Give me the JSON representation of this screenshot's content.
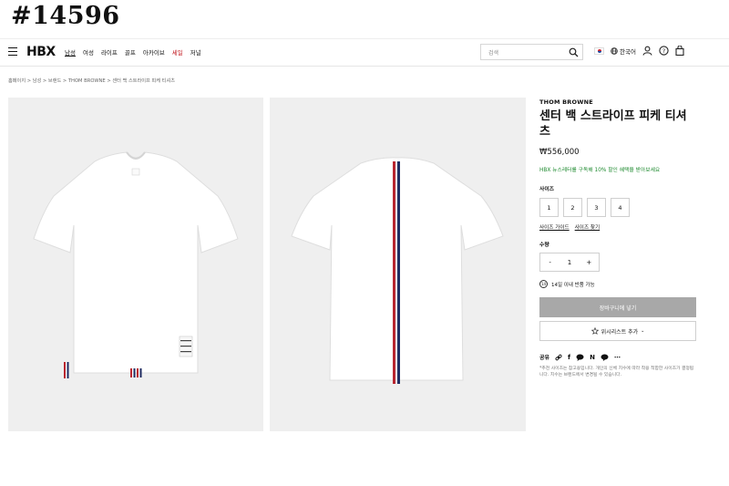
{
  "tag": "#14596",
  "header": {
    "logo": "HBX",
    "nav": [
      "남성",
      "여성",
      "라이프",
      "골프",
      "아카이브",
      "세일",
      "저널"
    ],
    "search_placeholder": "검색",
    "language": "한국어"
  },
  "breadcrumb": "홈페이지 > 남성 > 브랜드 > THOM BROWNE > 센터 백 스트라이프 피케 티셔츠",
  "product": {
    "brand": "THOM BROWNE",
    "title": "센터 백 스트라이프 피케 티셔츠",
    "price": "₩556,000",
    "promo": "HBX 뉴스레터를 구독해 10% 할인 혜택을 받아보세요",
    "size_label": "사이즈",
    "sizes": [
      "1",
      "2",
      "3",
      "4"
    ],
    "size_guide": "사이즈 가이드",
    "size_help": "사이즈 찾기",
    "qty_label": "수량",
    "qty_minus": "-",
    "qty_value": "1",
    "qty_plus": "+",
    "returns": "14일 이내 반품 가능",
    "returns_badge": "14",
    "add_to_cart": "장바구니에 넣기",
    "wishlist": "위시리스트 추가",
    "share_label": "공유",
    "note": "*추천 사이즈는 참고용입니다. 개인의 신체 치수에 따라 착용 적합한 사이즈가 결정됩니다. 치수는 브랜드에서 변경될 수 있습니다."
  },
  "icons": {
    "search": "search-icon",
    "user": "user-icon",
    "help": "help-icon",
    "bag": "bag-icon",
    "globe": "globe-icon",
    "heart": "heart-icon",
    "share": [
      "link-icon",
      "facebook-icon",
      "message-icon",
      "naver-icon",
      "kakao-icon",
      "more-icon"
    ]
  },
  "colors": {
    "sale": "#c0121a",
    "promo": "#1e8a2f",
    "cart_button": "#a8a8a8",
    "image_bg": "#efefef"
  }
}
